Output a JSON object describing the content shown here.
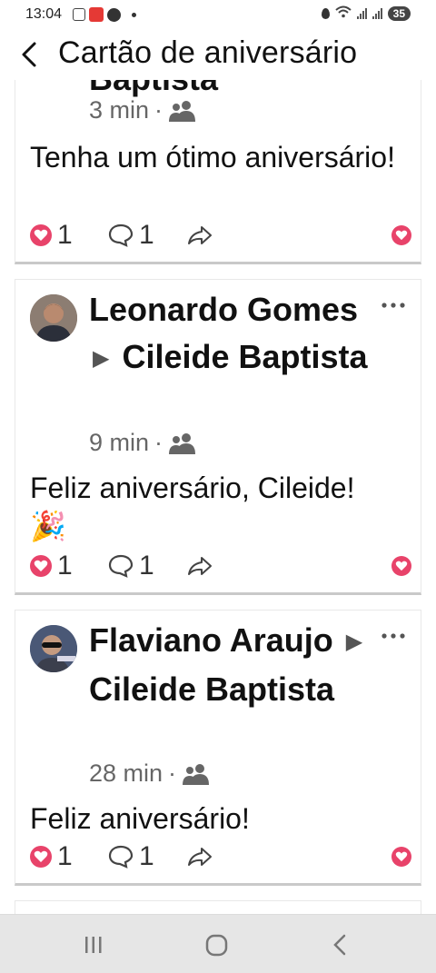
{
  "status_bar": {
    "time": "13:04",
    "battery": "35"
  },
  "header": {
    "title": "Cartão de aniversário"
  },
  "posts": [
    {
      "author_partial": "Baptista",
      "time": "3 min",
      "audience_icon": "friends-icon",
      "text": "Tenha um ótimo aniversário!",
      "reactions": "1",
      "comments": "1"
    },
    {
      "author": "Leonardo Gomes",
      "target": "Cileide Baptista",
      "time": "9 min",
      "audience_icon": "friends-icon",
      "text": "Feliz aniversário, Cileide!",
      "emoji": "🎉",
      "reactions": "1",
      "comments": "1"
    },
    {
      "author": "Flaviano Araujo",
      "target": "Cileide Baptista",
      "time": "28 min",
      "audience_icon": "friends-icon",
      "text": "Feliz aniversário!",
      "reactions": "1",
      "comments": "1"
    }
  ],
  "colors": {
    "love": "#e8436a",
    "meta": "#666666",
    "divider": "#c9c9c9",
    "navbar": "#e6e6e6"
  },
  "navbar": {
    "icons": [
      "recent-apps-icon",
      "home-icon",
      "back-icon"
    ]
  }
}
